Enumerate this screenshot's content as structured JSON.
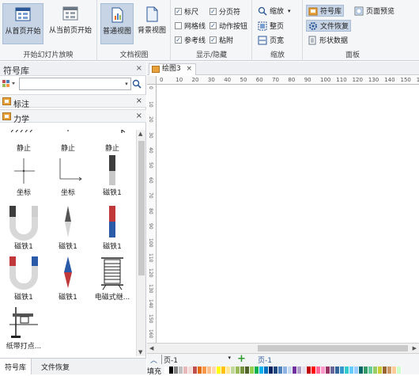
{
  "ribbon": {
    "groups": [
      {
        "title": "开始幻灯片放映"
      },
      {
        "title": "文档视图"
      },
      {
        "title": "显示/隐藏"
      },
      {
        "title": "缩放"
      },
      {
        "title": "面板"
      }
    ],
    "slideshow": {
      "from_start": "从首页开始",
      "from_current": "从当前页开始"
    },
    "views": {
      "normal": "普通视图",
      "background": "背景视图"
    },
    "show_hide": {
      "ruler": {
        "label": "标尺",
        "checked": true
      },
      "page_break": {
        "label": "分页符",
        "checked": true
      },
      "grid": {
        "label": "网格线",
        "checked": false
      },
      "action_button": {
        "label": "动作按钮",
        "checked": true
      },
      "guides": {
        "label": "参考线",
        "checked": true
      },
      "snap": {
        "label": "粘附",
        "checked": true
      }
    },
    "zoom": {
      "zoom_label": "缩放",
      "whole_page": "整页",
      "page_width": "页宽"
    },
    "panels": {
      "symbol_lib": "符号库",
      "file_recovery": "文件恢复",
      "page_preview": "页面预览",
      "shape_data": "形状数据"
    }
  },
  "left_panel": {
    "title": "符号库",
    "close": "×",
    "search_placeholder": "",
    "sections": [
      {
        "label": "标注",
        "close": "×"
      },
      {
        "label": "力学",
        "close": "×"
      }
    ],
    "shapes": [
      {
        "label": "静止",
        "icon": "static-support-icon"
      },
      {
        "label": "静止",
        "icon": "static-support-icon"
      },
      {
        "label": "静止",
        "icon": "static-support-icon"
      },
      {
        "label": "坐标",
        "icon": "coordinate-axes-icon"
      },
      {
        "label": "坐标",
        "icon": "coordinate-axes-corner-icon"
      },
      {
        "label": "磁铁1",
        "icon": "bar-magnet-vertical-icon"
      },
      {
        "label": "磁铁1",
        "icon": "u-magnet-icon"
      },
      {
        "label": "磁铁1",
        "icon": "needle-magnet-icon"
      },
      {
        "label": "磁铁1",
        "icon": "bar-magnet-red-blue-icon"
      },
      {
        "label": "磁铁1",
        "icon": "u-magnet-red-blue-icon"
      },
      {
        "label": "磁铁1",
        "icon": "compass-needle-icon"
      },
      {
        "label": "电磁式继...",
        "icon": "electromagnetic-relay-icon"
      },
      {
        "label": "纸带打点...",
        "icon": "ticker-timer-icon"
      }
    ],
    "tabs": [
      "符号库",
      "文件恢复"
    ]
  },
  "document": {
    "tab_label": "绘图3",
    "tab_close": "×",
    "ruler_h": [
      "0",
      "10",
      "20",
      "30",
      "40",
      "50",
      "60",
      "70",
      "80",
      "90",
      "100",
      "110",
      "120",
      "130",
      "140",
      "150",
      "160"
    ],
    "ruler_v": [
      "0",
      "10",
      "20",
      "30",
      "40",
      "50",
      "60",
      "70",
      "80",
      "90",
      "100",
      "110",
      "120",
      "130",
      "140",
      "150",
      "160"
    ]
  },
  "pagebar": {
    "page_select": "页-1",
    "add": "+",
    "page_tab": "页-1"
  },
  "colorbar": {
    "label": "填充",
    "colors": [
      "#ffffff",
      "#000000",
      "#7f7f7f",
      "#bfbfbf",
      "#e6b9b8",
      "#f2dcdb",
      "#c0504d",
      "#e46c0a",
      "#f79646",
      "#fac090",
      "#fcd5b4",
      "#ffff00",
      "#ffc000",
      "#ffe699",
      "#c4d79b",
      "#9bbb59",
      "#76923c",
      "#4f6228",
      "#92d050",
      "#00b050",
      "#00b0f0",
      "#0070c0",
      "#002060",
      "#1f497d",
      "#4f81bd",
      "#8db3e2",
      "#c6d9f0",
      "#7030a0",
      "#b1a0c7",
      "#e4dfec",
      "#c00000",
      "#ff0000",
      "#ff6699",
      "#ff99cc",
      "#993366",
      "#666699",
      "#336699",
      "#3399cc",
      "#33cccc",
      "#66ccff",
      "#99ccff",
      "#006666",
      "#339966",
      "#66cc99",
      "#99cc66",
      "#cccc33",
      "#996633",
      "#cc9966",
      "#ffcc99",
      "#ccffcc"
    ]
  }
}
